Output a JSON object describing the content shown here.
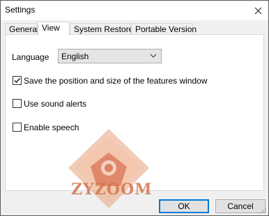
{
  "window": {
    "title": "Settings",
    "close_icon": "close-icon"
  },
  "tabs": [
    {
      "label": "General",
      "active": false
    },
    {
      "label": "View",
      "active": true
    },
    {
      "label": "System Restore",
      "active": false
    },
    {
      "label": "Portable Version",
      "active": false
    }
  ],
  "view": {
    "language_label": "Language",
    "language_value": "English",
    "options": [
      {
        "label": "Save the position and size of the features window",
        "checked": true
      },
      {
        "label": "Use sound alerts",
        "checked": false
      },
      {
        "label": "Enable speech",
        "checked": false
      }
    ]
  },
  "watermark": {
    "text": "ZYZOOM",
    "color": "#d4764e"
  },
  "buttons": {
    "ok": "OK",
    "cancel": "Cancel"
  },
  "colors": {
    "accent": "#0078d7"
  }
}
